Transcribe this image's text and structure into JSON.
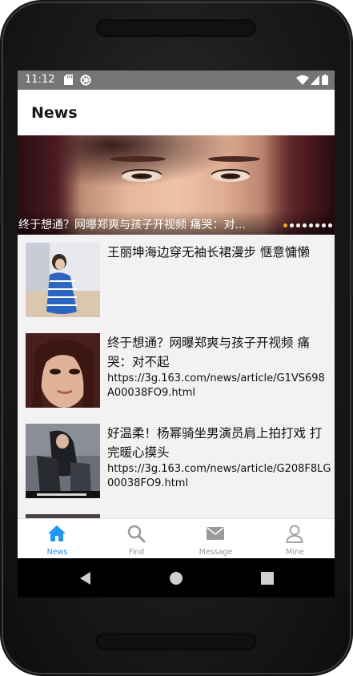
{
  "status": {
    "time": "11:12",
    "left_icons": [
      "sd-card-icon",
      "sync-icon"
    ],
    "right_icons": [
      "wifi-icon",
      "signal-icon",
      "battery-icon"
    ]
  },
  "appbar": {
    "title": "News"
  },
  "banner": {
    "caption": "终于想通？网曝郑爽与孩子开视频 痛哭：对...",
    "page_count": 8,
    "active_index": 0
  },
  "news": [
    {
      "title": "王丽坤海边穿无袖长裙漫步 惬意慵懒",
      "url": ""
    },
    {
      "title": "终于想通？网曝郑爽与孩子开视频 痛哭：对不起",
      "url": "https://3g.163.com/news/article/G1VS698A00038FO9.html"
    },
    {
      "title": "好温柔！杨幂骑坐男演员肩上拍打戏 打完暖心摸头",
      "url": "https://3g.163.com/news/article/G208F8LG00038FO9.html"
    }
  ],
  "tabs": [
    {
      "label": "News",
      "icon": "home-icon",
      "active": true
    },
    {
      "label": "Find",
      "icon": "search-icon",
      "active": false
    },
    {
      "label": "Message",
      "icon": "mail-icon",
      "active": false
    },
    {
      "label": "Mine",
      "icon": "person-icon",
      "active": false
    }
  ],
  "colors": {
    "accent": "#2196f3",
    "status_bar": "#757575",
    "banner_dot_active": "#f5a623"
  }
}
